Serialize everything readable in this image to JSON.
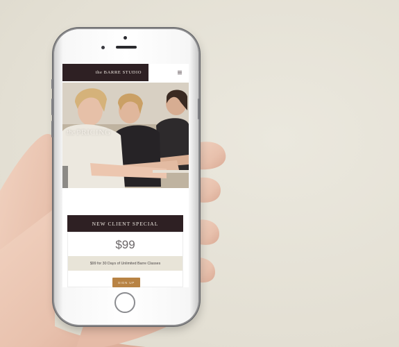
{
  "site": {
    "brand": "the BARRE STUDIO",
    "menu_icon": "hamburger-menu-icon"
  },
  "hero": {
    "title_italic": "the",
    "title": "PRICING"
  },
  "offer": {
    "heading": "NEW CLIENT SPECIAL",
    "price": "$99",
    "description": "$99 for 30 Days of Unlimited Barre Classes",
    "cta": "SIGN UP"
  },
  "colors": {
    "brand_dark": "#2e2023",
    "accent": "#b88344",
    "band": "#e8e4d8",
    "background": "#e6e2d6"
  }
}
